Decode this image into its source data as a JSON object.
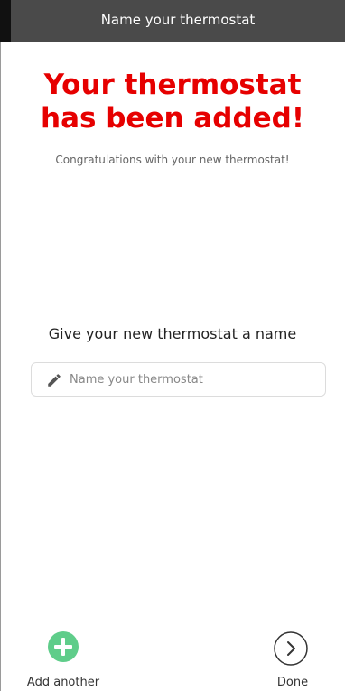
{
  "header": {
    "title": "Name your thermostat"
  },
  "main": {
    "headline": "Your thermostat has been added!",
    "subtitle": "Congratulations with your new thermostat!",
    "name_prompt": "Give your new thermostat a name",
    "name_field": {
      "value": "",
      "placeholder": "Name your thermostat",
      "icon": "pencil-icon"
    }
  },
  "footer": {
    "add_another": {
      "label": "Add another",
      "icon": "plus-circle-icon",
      "color": "#5fcd8a"
    },
    "done": {
      "label": "Done",
      "icon": "chevron-right-circle-icon"
    }
  },
  "colors": {
    "headline": "#e60000",
    "topbar": "#4a4a4a"
  }
}
